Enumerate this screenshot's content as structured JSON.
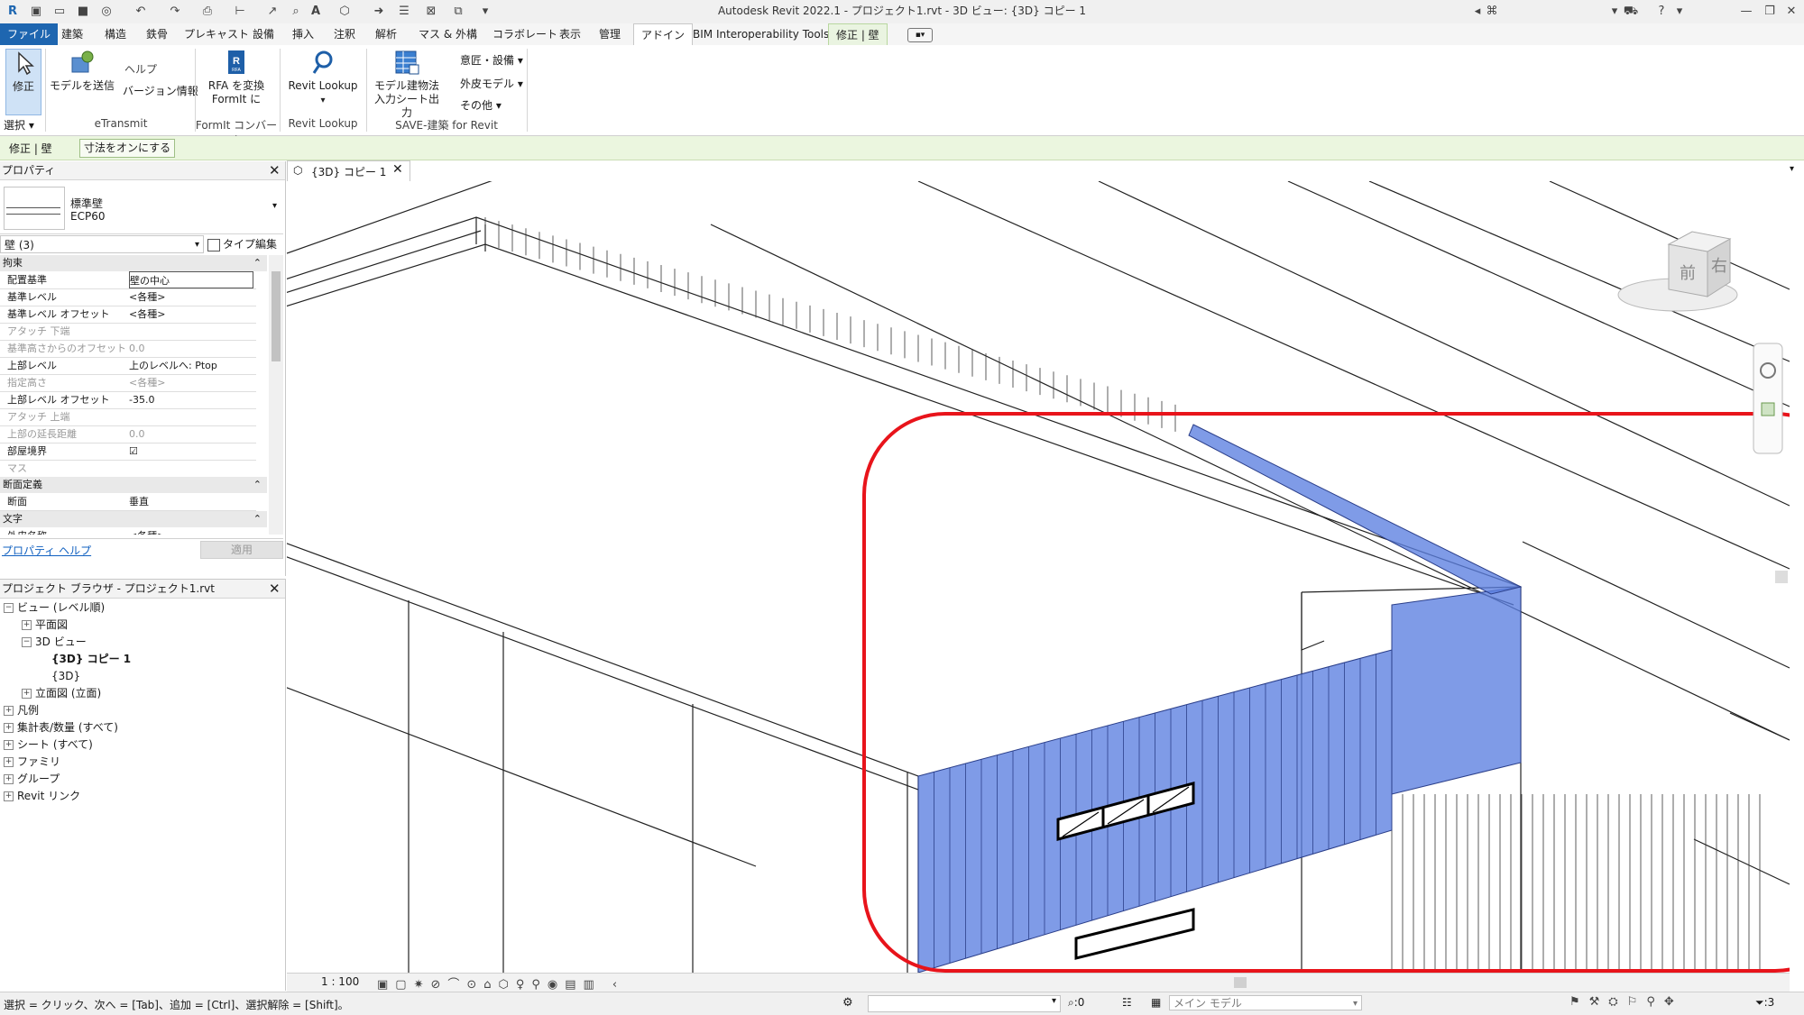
{
  "window": {
    "title": "Autodesk Revit 2022.1 - プロジェクト1.rvt - 3D ビュー: {3D} コピー 1"
  },
  "ribbon_tabs": [
    "ファイル",
    "建築",
    "構造",
    "鉄骨",
    "プレキャスト",
    "設備",
    "挿入",
    "注釈",
    "解析",
    "マス & 外構",
    "コラボレート",
    "表示",
    "管理",
    "アドイン",
    "BIM Interoperability Tools",
    "修正 | 壁"
  ],
  "ribbon": {
    "modify_label": "修正",
    "select_label": "選択 ▾",
    "send_model_label": "モデルを送信",
    "help_label": "ヘルプ",
    "version_label": "バージョン情報",
    "etransmit_panel": "eTransmit",
    "rfa_line1": "RFA を変換",
    "rfa_line2": "FormIt に",
    "formit_panel": "FormIt コンバータ",
    "revit_lookup_label": "Revit Lookup",
    "revit_lookup_panel": "Revit Lookup",
    "save_line1": "モデル建物法",
    "save_line2": "入力シート出力",
    "save_menu1": "意匠・設備",
    "save_menu2": "外皮モデル",
    "save_menu3": "その他",
    "save_panel": "SAVE-建築 for Revit"
  },
  "modify_bar": {
    "context": "修正 | 壁",
    "dimension_toggle": "寸法をオンにする"
  },
  "properties": {
    "title": "プロパティ",
    "type_name": "標準壁",
    "type_sub": "ECP60",
    "instance_filter": "壁 (3)",
    "edit_type": "タイプ編集",
    "section_constraints": "拘束",
    "rows": [
      {
        "name": "配置基準",
        "value": "壁の中心",
        "grey": false
      },
      {
        "name": "基準レベル",
        "value": "<各種>",
        "grey": false
      },
      {
        "name": "基準レベル オフセット",
        "value": "<各種>",
        "grey": false
      },
      {
        "name": "アタッチ 下端",
        "value": "",
        "grey": true
      },
      {
        "name": "基準高さからのオフセット",
        "value": "0.0",
        "grey": true
      },
      {
        "name": "上部レベル",
        "value": "上のレベルへ: Ptop",
        "grey": false
      },
      {
        "name": "指定高さ",
        "value": "<各種>",
        "grey": true
      },
      {
        "name": "上部レベル オフセット",
        "value": "-35.0",
        "grey": false
      },
      {
        "name": "アタッチ 上端",
        "value": "",
        "grey": true
      },
      {
        "name": "上部の延長距離",
        "value": "0.0",
        "grey": true
      },
      {
        "name": "部屋境界",
        "value": "☑",
        "grey": false
      },
      {
        "name": "マス",
        "value": "",
        "grey": true
      }
    ],
    "section_profile": "断面定義",
    "profile_name": "断面",
    "profile_value": "垂直",
    "section_text": "文字",
    "text_row_name": "外皮名称",
    "text_row_value": "<各種>",
    "help_link": "プロパティ ヘルプ",
    "apply_button": "適用"
  },
  "project_browser": {
    "title": "プロジェクト ブラウザ - プロジェクト1.rvt",
    "items": [
      {
        "label": "ビュー (レベル順)",
        "depth": 0,
        "exp": "−"
      },
      {
        "label": "平面図",
        "depth": 1,
        "exp": "+"
      },
      {
        "label": "3D ビュー",
        "depth": 1,
        "exp": "−"
      },
      {
        "label": "{3D} コピー 1",
        "depth": 2,
        "exp": ""
      },
      {
        "label": "{3D}",
        "depth": 2,
        "exp": ""
      },
      {
        "label": "立面図 (立面)",
        "depth": 1,
        "exp": "+"
      },
      {
        "label": "凡例",
        "depth": 0,
        "exp": "+"
      },
      {
        "label": "集計表/数量 (すべて)",
        "depth": 0,
        "exp": "+"
      },
      {
        "label": "シート (すべて)",
        "depth": 0,
        "exp": "+"
      },
      {
        "label": "ファミリ",
        "depth": 0,
        "exp": "+"
      },
      {
        "label": "グループ",
        "depth": 0,
        "exp": "+"
      },
      {
        "label": "Revit リンク",
        "depth": 0,
        "exp": "+"
      }
    ]
  },
  "view": {
    "tab_label": "{3D} コピー 1",
    "scale": "1 : 100",
    "viewcube_front": "前",
    "viewcube_right": "右",
    "selection_color": "#5b7fe0",
    "highlight_color": "#e8141b"
  },
  "status": {
    "message": "選択 = クリック、次へ = [Tab]、追加 = [Ctrl]、選択解除 = [Shift]。",
    "workset_count": ":0",
    "model_label": "メイン モデル",
    "filter_count": ":3"
  }
}
